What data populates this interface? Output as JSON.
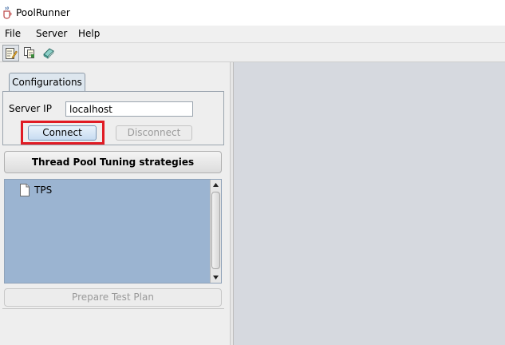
{
  "window": {
    "title": "PoolRunner",
    "app_icon": "java-cup-icon"
  },
  "menubar": {
    "items": [
      "File",
      "Server",
      "Help"
    ]
  },
  "toolbar": {
    "buttons": [
      "edit-document-icon",
      "copy-document-icon",
      "book-icon"
    ]
  },
  "left_panel": {
    "tab": "Configurations",
    "server_ip_label": "Server IP",
    "server_ip_value": "localhost",
    "connect_label": "Connect",
    "disconnect_label": "Disconnect",
    "section_title": "Thread Pool Tuning strategies",
    "tree_items": [
      "TPS"
    ],
    "prepare_label": "Prepare Test Plan"
  },
  "colors": {
    "highlight": "#e01b24",
    "list_background": "#9bb4d1",
    "right_panel": "#d6d9df"
  }
}
